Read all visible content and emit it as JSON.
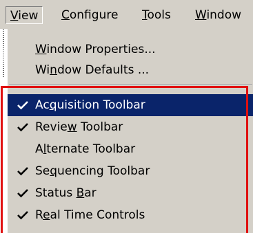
{
  "menubar": {
    "view": {
      "pre": "",
      "ul": "V",
      "post": "iew"
    },
    "configure": {
      "pre": "",
      "ul": "C",
      "post": "onfigure"
    },
    "tools": {
      "pre": "",
      "ul": "T",
      "post": "ools"
    },
    "window": {
      "pre": "",
      "ul": "W",
      "post": "indow"
    }
  },
  "dropdown": {
    "window_properties": {
      "pre": "",
      "ul": "W",
      "post": "indow Properties..."
    },
    "window_defaults": {
      "pre": "Wi",
      "ul": "n",
      "post": "dow Defaults ..."
    },
    "acquisition_toolbar": {
      "pre": "Ac",
      "ul": "q",
      "post": "uisition Toolbar",
      "checked": true,
      "selected": true
    },
    "review_toolbar": {
      "pre": "Revie",
      "ul": "w",
      "post": " Toolbar",
      "checked": true
    },
    "alternate_toolbar": {
      "pre": "A",
      "ul": "l",
      "post": "ternate Toolbar",
      "checked": false
    },
    "sequencing_toolbar": {
      "pre": "Se",
      "ul": "q",
      "post": "uencing Toolbar",
      "checked": true
    },
    "status_bar": {
      "pre": "Status ",
      "ul": "B",
      "post": "ar",
      "checked": true
    },
    "real_time_controls": {
      "pre": "R",
      "ul": "e",
      "post": "al Time Controls",
      "checked": true
    }
  },
  "colors": {
    "menu_bg": "#d4d0c8",
    "selection_bg": "#0a246a",
    "highlight_border": "#e01010"
  },
  "icons": {
    "check": "check-icon"
  }
}
